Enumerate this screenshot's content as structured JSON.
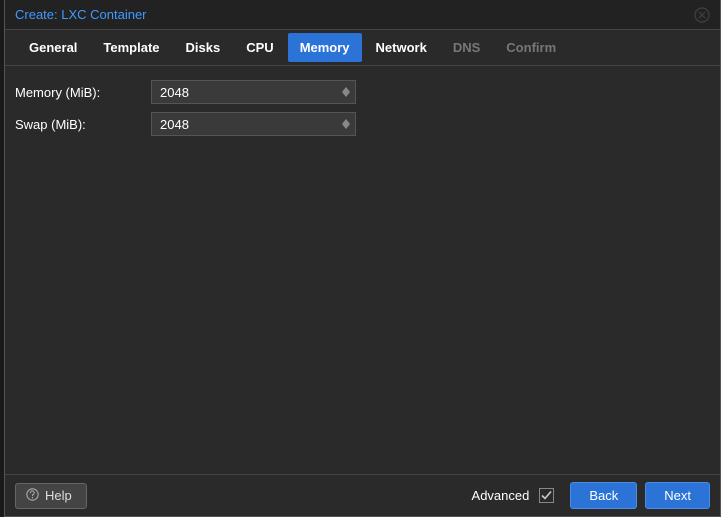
{
  "dialog": {
    "title": "Create: LXC Container"
  },
  "tabs": {
    "general": "General",
    "template": "Template",
    "disks": "Disks",
    "cpu": "CPU",
    "memory": "Memory",
    "network": "Network",
    "dns": "DNS",
    "confirm": "Confirm"
  },
  "form": {
    "memory_label": "Memory (MiB):",
    "memory_value": "2048",
    "swap_label": "Swap (MiB):",
    "swap_value": "2048"
  },
  "footer": {
    "help": "Help",
    "advanced": "Advanced",
    "back": "Back",
    "next": "Next"
  }
}
